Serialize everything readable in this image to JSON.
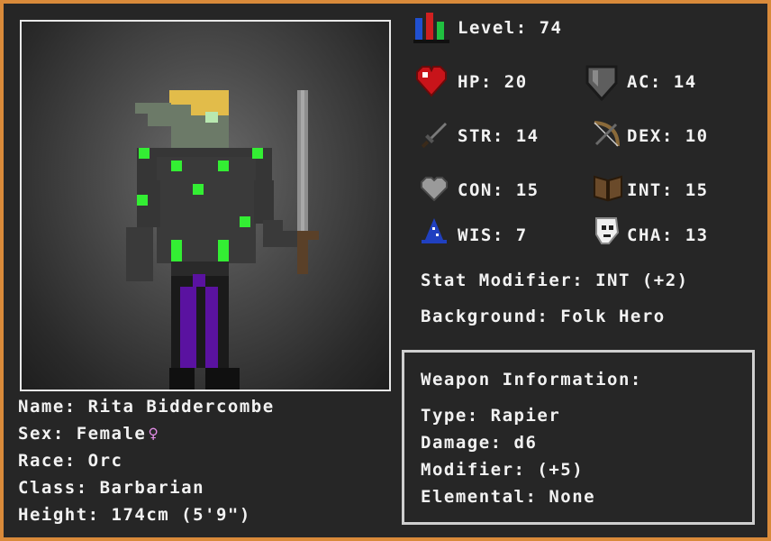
{
  "character": {
    "name_label": "Name:",
    "name": "Rita Biddercombe",
    "sex_label": "Sex:",
    "sex": "Female",
    "sex_symbol": "♀",
    "race_label": "Race:",
    "race": "Orc",
    "class_label": "Class:",
    "class": "Barbarian",
    "height_label": "Height:",
    "height": "174cm (5'9\")"
  },
  "stats": {
    "level_label": "Level:",
    "level": "74",
    "hp_label": "HP:",
    "hp": "20",
    "ac_label": "AC:",
    "ac": "14",
    "str_label": "STR:",
    "str": "14",
    "dex_label": "DEX:",
    "dex": "10",
    "con_label": "CON:",
    "con": "15",
    "int_label": "INT:",
    "int": "15",
    "wis_label": "WIS:",
    "wis": "7",
    "cha_label": "CHA:",
    "cha": "13"
  },
  "stat_modifier": {
    "label": "Stat Modifier:",
    "value": "INT (+2)"
  },
  "background": {
    "label": "Background:",
    "value": "Folk Hero"
  },
  "weapon": {
    "title": "Weapon Information:",
    "type_label": "Type:",
    "type": "Rapier",
    "damage_label": "Damage:",
    "damage": "d6",
    "modifier_label": "Modifier:",
    "modifier": "(+5)",
    "elemental_label": "Elemental:",
    "elemental": "None"
  },
  "colors": {
    "frame": "#d98a3a",
    "panel": "#262626",
    "text": "#f2f2f2",
    "accent_green": "#33ee33",
    "accent_purple": "#5a12a0"
  },
  "icons": [
    "level-bars-icon",
    "heart-icon",
    "shield-icon",
    "sword-icon",
    "bow-icon",
    "con-heart-icon",
    "book-icon",
    "wizard-hat-icon",
    "mask-icon"
  ]
}
